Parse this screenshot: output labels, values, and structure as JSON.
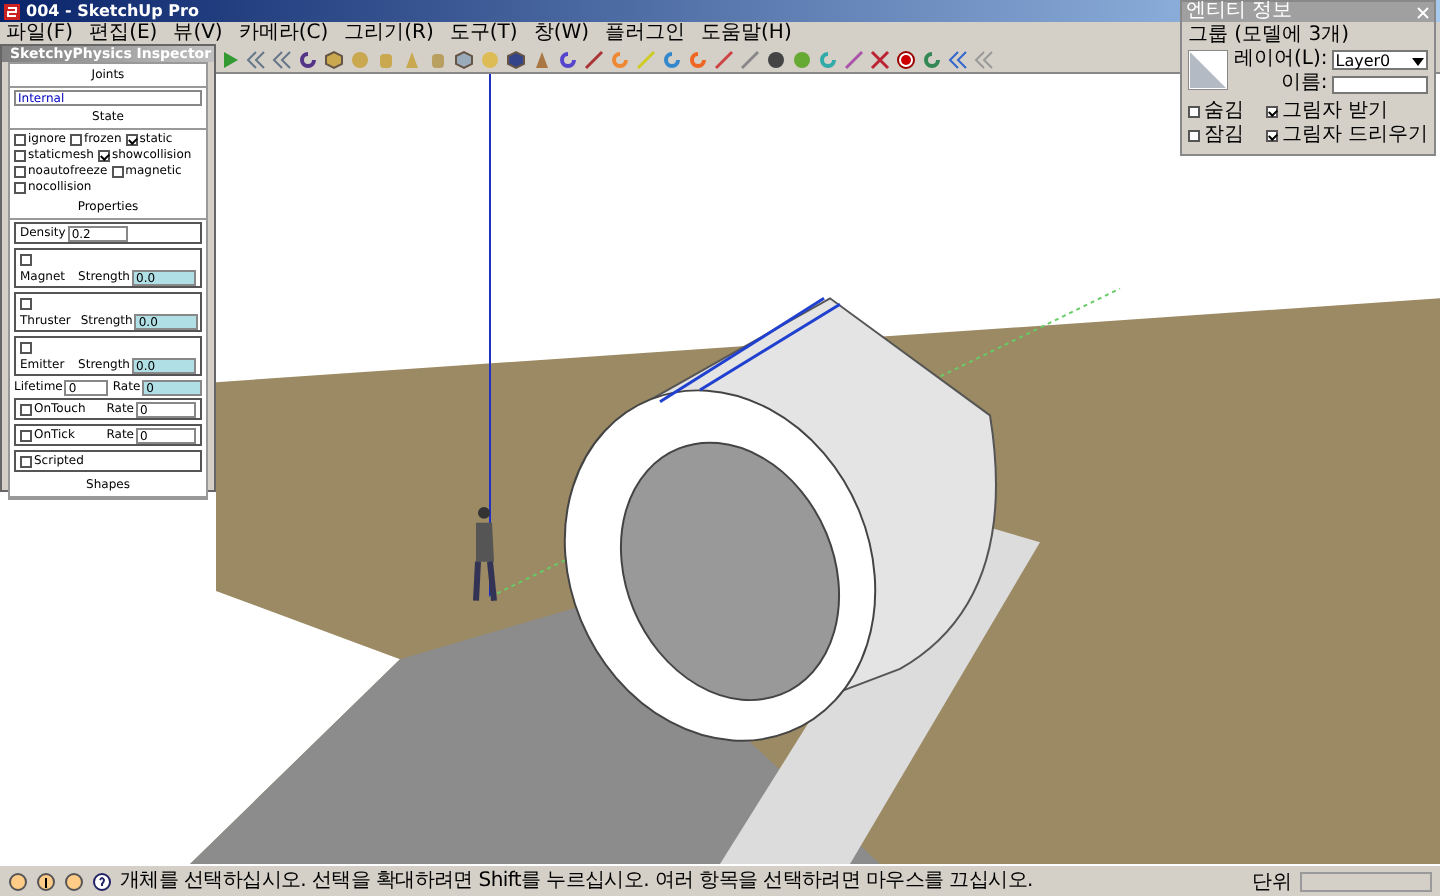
{
  "window": {
    "title": "004 - SketchUp Pro"
  },
  "menu": [
    "파일(F)",
    "편집(E)",
    "뷰(V)",
    "카메라(C)",
    "그리기(R)",
    "도구(T)",
    "창(W)",
    "플러그인",
    "도움말(H)"
  ],
  "inspector": {
    "title": "SketchyPhysics Inspector",
    "joints_header": "Joints",
    "joint_value": "Internal",
    "state_header": "State",
    "state": [
      {
        "label": "ignore",
        "checked": false
      },
      {
        "label": "frozen",
        "checked": false
      },
      {
        "label": "static",
        "checked": true
      },
      {
        "label": "staticmesh",
        "checked": false
      },
      {
        "label": "showcollision",
        "checked": true
      },
      {
        "label": "noautofreeze",
        "checked": false
      },
      {
        "label": "magnetic",
        "checked": false
      },
      {
        "label": "nocollision",
        "checked": false
      }
    ],
    "properties_header": "Properties",
    "density": {
      "label": "Density",
      "value": "0.2"
    },
    "forces": [
      {
        "label": "Magnet",
        "checked": false,
        "strength_label": "Strength",
        "value": "0.0"
      },
      {
        "label": "Thruster",
        "checked": false,
        "strength_label": "Strength",
        "value": "0.0"
      },
      {
        "label": "Emitter",
        "checked": false,
        "strength_label": "Strength",
        "value": "0.0"
      }
    ],
    "lifetime": {
      "label": "Lifetime",
      "value": "0",
      "rate_label": "Rate",
      "rate": "0"
    },
    "events": [
      {
        "label": "OnTouch",
        "checked": false,
        "rate_label": "Rate",
        "rate": "0"
      },
      {
        "label": "OnTick",
        "checked": false,
        "rate_label": "Rate",
        "rate": "0"
      }
    ],
    "scripted": {
      "label": "Scripted",
      "checked": false
    },
    "shapes_header": "Shapes"
  },
  "entity_info": {
    "title": "엔티티 정보",
    "heading": "그룹 (모델에 3개)",
    "layer_label": "레이어(L):",
    "layer": "Layer0",
    "name_label": "이름:",
    "options": [
      {
        "label": "숨김",
        "checked": false
      },
      {
        "label": "잠김",
        "checked": false
      },
      {
        "label": "그림자 받기",
        "checked": true
      },
      {
        "label": "그림자 드리우기",
        "checked": true
      }
    ]
  },
  "status_bar": {
    "message": "개체를 선택하십시오. 선택을 확대하려면 Shift를 누르십시오. 여러 항목을 선택하려면 마우스를 끄십시오.",
    "units_label": "단위"
  }
}
